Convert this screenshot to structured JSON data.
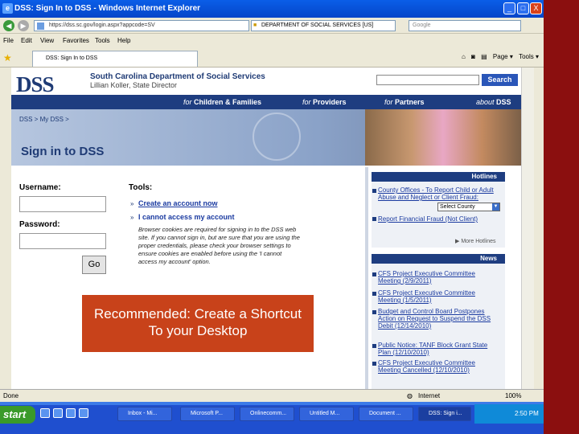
{
  "window": {
    "title": "DSS: Sign In to DSS - Windows Internet Explorer",
    "min_glyph": "_",
    "max_glyph": "□",
    "close_glyph": "X"
  },
  "toolbar": {
    "back_glyph": "◀",
    "forward_glyph": "▶",
    "address": "https://dss.sc.gov/login.aspx?appcode=SV",
    "cert_label": "DEPARTMENT OF SOCIAL SERVICES [US]",
    "search_placeholder": "Google"
  },
  "menu": [
    "File",
    "Edit",
    "View",
    "Favorites",
    "Tools",
    "Help"
  ],
  "tab": {
    "label": "DSS: Sign In to DSS"
  },
  "command_bar": [
    "Page ▾",
    "Tools ▾"
  ],
  "site": {
    "logo": "DSS",
    "agency": "South Carolina Department of Social Services",
    "director": "Lillian Koller, State Director",
    "search_button": "Search",
    "nav": [
      {
        "pre": "for",
        "label": "Children & Families"
      },
      {
        "pre": "for",
        "label": "Providers"
      },
      {
        "pre": "for",
        "label": "Partners"
      },
      {
        "pre": "about",
        "label": "DSS"
      }
    ],
    "breadcrumb": "DSS > My DSS >",
    "page_title": "Sign in to DSS"
  },
  "form": {
    "username_label": "Username:",
    "password_label": "Password:",
    "go_label": "Go"
  },
  "tools": {
    "heading": "Tools:",
    "create_link": "Create an account now",
    "access_link": "I cannot access my account",
    "note": "Browser cookies are required for signing in to the DSS web site. If you cannot sign in, but are sure that you are using the proper credentials, please check your browser settings to ensure cookies are enabled before using the 'I cannot access my account' option."
  },
  "hotlines": {
    "heading": "Hotlines",
    "item1": "County Offices - To Report Child or Adult Abuse and Neglect or Client Fraud:",
    "select_value": "Select County",
    "item2": "Report Financial Fraud (Not Client)",
    "more": "More Hotlines"
  },
  "news": {
    "heading": "News",
    "items": [
      "CFS Project Executive Committee Meeting (2/9/2011)",
      "CFS Project Executive Committee Meeting (1/5/2011)",
      "Budget and Control Board Postpones Action on Request to Suspend the DSS Debit (12/14/2010)",
      "Public Notice: TANF Block Grant State Plan (12/10/2010)",
      "CFS Project Executive Committee Meeting Cancelled (12/10/2010)"
    ]
  },
  "callout": {
    "line1": "Recommended: Create a Shortcut",
    "line2": "To your Desktop"
  },
  "statusbar": {
    "left": "Done",
    "zone": "Internet",
    "zoom": "100%"
  },
  "taskbar": {
    "start": "start",
    "items": [
      "Inbox - Mi...",
      "Microsoft P...",
      "Onlinecomm...",
      "Untitled M...",
      "Document ...",
      "DSS: Sign i..."
    ],
    "clock": "2:50 PM"
  }
}
